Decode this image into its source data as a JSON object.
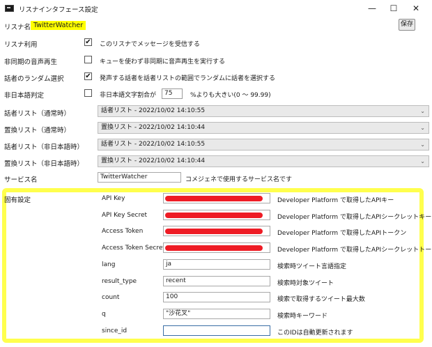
{
  "window": {
    "title": "リスナインタフェース設定",
    "minimize": "—",
    "maximize": "☐",
    "close": "✕"
  },
  "header": {
    "listener_label": "リスナ名",
    "listener_name": "TwitterWatcher",
    "save_label": "保存"
  },
  "options": [
    {
      "label": "リスナ利用",
      "checked": true,
      "text": "このリスナでメッセージを受信する"
    },
    {
      "label": "非同期の音声再生",
      "checked": false,
      "text": "キューを使わず非同期に音声再生を実行する"
    },
    {
      "label": "話者のランダム選択",
      "checked": true,
      "text": "発声する話者を話者リストの範囲でランダムに話者を選択する"
    },
    {
      "label": "非日本語判定",
      "checked": false,
      "text_before": "非日本語文字割合が",
      "value": "75",
      "text_after": "%よりも大きい(0 〜 99.99)"
    }
  ],
  "lists": [
    {
      "label": "話者リスト（通常時）",
      "value": "話者リスト - 2022/10/02 14:10:55"
    },
    {
      "label": "置換リスト（通常時）",
      "value": "置換リスト - 2022/10/02 14:10:44"
    },
    {
      "label": "話者リスト（非日本語時）",
      "value": "話者リスト - 2022/10/02 14:10:55"
    },
    {
      "label": "置換リスト（非日本語時）",
      "value": "置換リスト - 2022/10/02 14:10:44"
    }
  ],
  "service": {
    "label": "サービス名",
    "value": "TwitterWatcher",
    "desc": "コメジェネで使用するサービス名です"
  },
  "specific": {
    "label": "固有設定",
    "fields": [
      {
        "label": "API Key",
        "value": "",
        "redacted": true,
        "desc": "Developer Platform で取得したAPIキー"
      },
      {
        "label": "API Key Secret",
        "value": "",
        "redacted": true,
        "desc": "Developer Platform で取得したAPIシークレットキー"
      },
      {
        "label": "Access Token",
        "value": "",
        "redacted": true,
        "desc": "Developer Platform で取得したAPIトークン"
      },
      {
        "label": "Access Token Secret",
        "value": "",
        "redacted": true,
        "desc": "Developer Platform で取得したAPIシークレットトークン"
      },
      {
        "label": "lang",
        "value": "ja",
        "desc": "検索時ツイート言語指定"
      },
      {
        "label": "result_type",
        "value": "recent",
        "desc": "検索時対象ツイート"
      },
      {
        "label": "count",
        "value": "100",
        "desc": "検索で取得するツイート最大数"
      },
      {
        "label": "q",
        "value": "\"沙花叉\"",
        "desc": "検索時キーワード"
      },
      {
        "label": "since_id",
        "value": "",
        "focused": true,
        "desc": "このIDは自動更新されます"
      }
    ]
  },
  "colors": {
    "highlight": "#ffff00",
    "panel_border": "#ffff4d",
    "redaction": "#ee1c25"
  }
}
